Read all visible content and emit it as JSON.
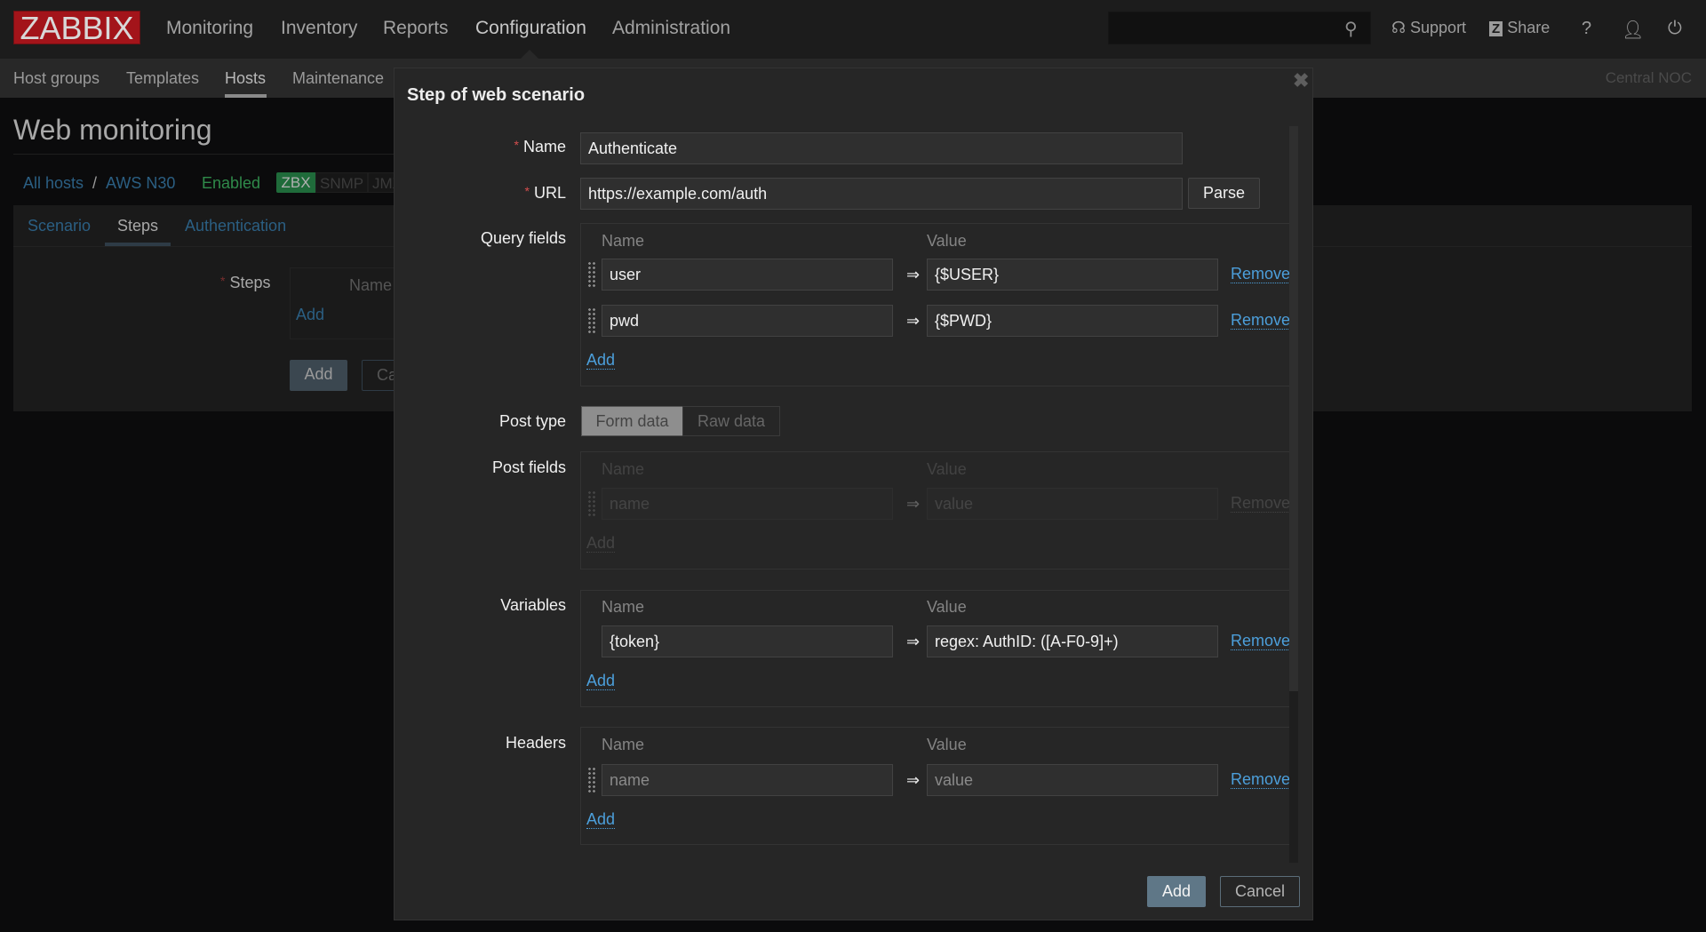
{
  "header": {
    "logo": "ZABBIX",
    "nav": [
      "Monitoring",
      "Inventory",
      "Reports",
      "Configuration",
      "Administration"
    ],
    "active_nav": "Configuration",
    "search": {
      "value": "",
      "placeholder": ""
    },
    "tools": {
      "support": "Support",
      "share": "Share",
      "help": "?"
    },
    "icons": [
      "search-icon",
      "headset-icon",
      "zabbix-share-icon",
      "help-icon",
      "user-icon",
      "power-icon"
    ]
  },
  "subnav": {
    "items": [
      "Host groups",
      "Templates",
      "Hosts",
      "Maintenance"
    ],
    "active": "Hosts",
    "server_name": "Central NOC"
  },
  "page": {
    "title": "Web monitoring",
    "breadcrumb": {
      "all_hosts": "All hosts",
      "separator": "/",
      "host": "AWS N30",
      "status": "Enabled"
    },
    "availability": {
      "zbx": "ZBX",
      "snmp": "SNMP",
      "jmx": "JMX"
    },
    "tabs": [
      "Scenario",
      "Steps",
      "Authentication"
    ],
    "active_tab": "Steps",
    "steps": {
      "label": "Steps",
      "name_header": "Name",
      "add_link": "Add"
    },
    "buttons": {
      "add": "Add",
      "cancel": "Cancel"
    }
  },
  "modal": {
    "title": "Step of web scenario",
    "close_icon": "close-icon",
    "name": {
      "label": "Name",
      "value": "Authenticate"
    },
    "url": {
      "label": "URL",
      "value": "https://example.com/auth",
      "parse": "Parse"
    },
    "query_fields": {
      "label": "Query fields",
      "name_header": "Name",
      "value_header": "Value",
      "rows": [
        {
          "name": "user",
          "value": "{$USER}"
        },
        {
          "name": "pwd",
          "value": "{$PWD}"
        }
      ],
      "remove": "Remove",
      "add": "Add"
    },
    "post_type": {
      "label": "Post type",
      "options": [
        "Form data",
        "Raw data"
      ],
      "selected": "Form data"
    },
    "post_fields": {
      "label": "Post fields",
      "name_header": "Name",
      "value_header": "Value",
      "rows": [
        {
          "name_placeholder": "name",
          "value_placeholder": "value"
        }
      ],
      "remove": "Remove",
      "add": "Add",
      "disabled": true
    },
    "variables": {
      "label": "Variables",
      "name_header": "Name",
      "value_header": "Value",
      "rows": [
        {
          "name": "{token}",
          "value": "regex: AuthID: ([A-F0-9]+)"
        }
      ],
      "remove": "Remove",
      "add": "Add"
    },
    "headers": {
      "label": "Headers",
      "name_header": "Name",
      "value_header": "Value",
      "rows": [
        {
          "name_placeholder": "name",
          "value_placeholder": "value"
        }
      ],
      "remove": "Remove",
      "add": "Add"
    },
    "footer": {
      "add": "Add",
      "cancel": "Cancel"
    }
  },
  "colors": {
    "logo": "#a3141a",
    "link": "#4c9fdb",
    "primary_button": "#5f7787",
    "zbx_available": "#1f6b3a",
    "enabled": "#2f8a4a",
    "required": "#d64e4e"
  }
}
